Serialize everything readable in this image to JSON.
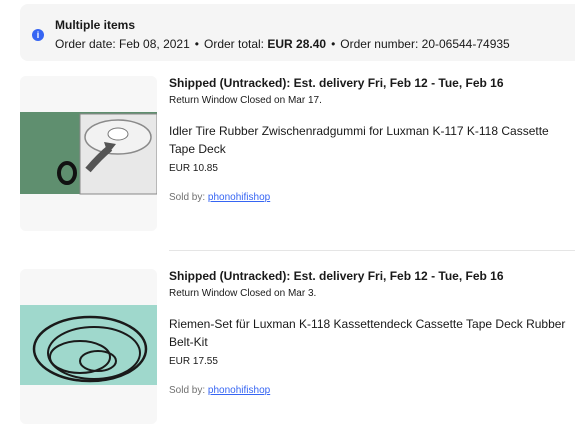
{
  "banner": {
    "title": "Multiple items",
    "order_date_label": "Order date:",
    "order_date": "Feb 08, 2021",
    "order_total_label": "Order total:",
    "order_total": "EUR 28.40",
    "order_number_label": "Order number:",
    "order_number": "20-06544-74935",
    "separator": "•",
    "icon": "info-icon"
  },
  "items": [
    {
      "status": "Shipped (Untracked): Est. delivery Fri, Feb 12 - Tue, Feb 16",
      "return_window": "Return Window Closed on Mar 17.",
      "title": "Idler Tire Rubber Zwischenradgummi for Luxman K-117 K-118 Cassette Tape Deck",
      "price": "EUR 10.85",
      "sold_by_label": "Sold by:",
      "seller": "phonohifishop"
    },
    {
      "status": "Shipped (Untracked): Est. delivery Fri, Feb 12 - Tue, Feb 16",
      "return_window": "Return Window Closed on Mar 3.",
      "title": "Riemen-Set für Luxman K-118 Kassettendeck Cassette Tape Deck Rubber Belt-Kit",
      "price": "EUR 17.55",
      "sold_by_label": "Sold by:",
      "seller": "phonohifishop"
    }
  ]
}
